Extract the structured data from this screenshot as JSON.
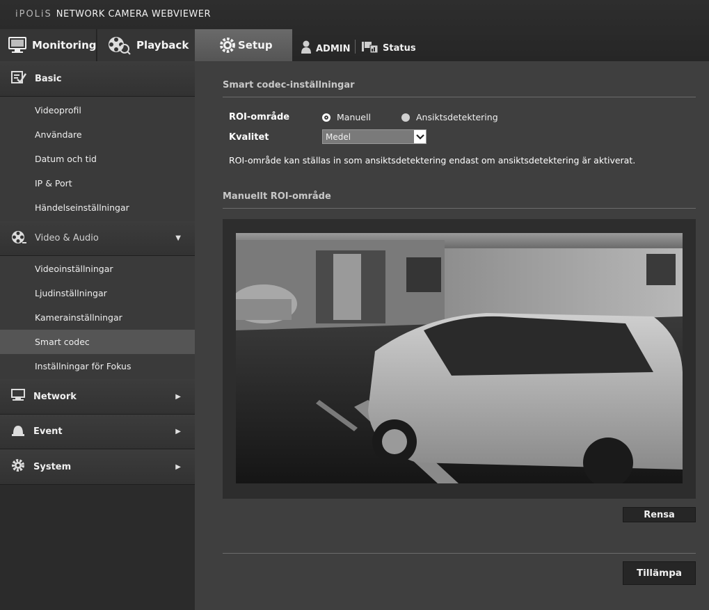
{
  "brand": {
    "prefix": "iPOLiS",
    "title": "NETWORK CAMERA WEBVIEWER"
  },
  "tabs": [
    {
      "label": "Monitoring"
    },
    {
      "label": "Playback"
    },
    {
      "label": "Setup"
    }
  ],
  "user": {
    "label": "ADMIN"
  },
  "status": {
    "label": "Status"
  },
  "sidebar": {
    "basic": {
      "label": "Basic",
      "items": [
        "Videoprofil",
        "Användare",
        "Datum och tid",
        "IP & Port",
        "Händelseinställningar"
      ]
    },
    "video_audio": {
      "label": "Video & Audio",
      "items": [
        "Videoinställningar",
        "Ljudinställningar",
        "Kamerainställningar",
        "Smart codec",
        "Inställningar för Fokus"
      ],
      "active": "Smart codec"
    },
    "network": {
      "label": "Network"
    },
    "event": {
      "label": "Event"
    },
    "system": {
      "label": "System"
    }
  },
  "main": {
    "section1_title": "Smart codec-inställningar",
    "roi_label": "ROI-område",
    "roi_options": [
      "Manuell",
      "Ansiktsdetektering"
    ],
    "roi_selected": "Manuell",
    "quality_label": "Kvalitet",
    "quality_value": "Medel",
    "note": "ROI-område kan ställas in som ansiktsdetektering endast om ansiktsdetektering är aktiverat.",
    "section2_title": "Manuellt ROI-område",
    "clear_label": "Rensa",
    "apply_label": "Tillämpa"
  },
  "colors": {
    "accent_tab": "#5f5f5f",
    "active_item": "#555555",
    "panel": "#3f3f3f"
  },
  "icons": {
    "monitoring": "monitor-icon",
    "playback": "film-reel-icon",
    "setup": "gear-icon",
    "admin": "user-icon",
    "status": "status-icon",
    "basic": "checklist-icon",
    "video_audio": "film-reel-icon",
    "network": "computer-icon",
    "event": "alarm-icon",
    "system": "gear-icon"
  }
}
